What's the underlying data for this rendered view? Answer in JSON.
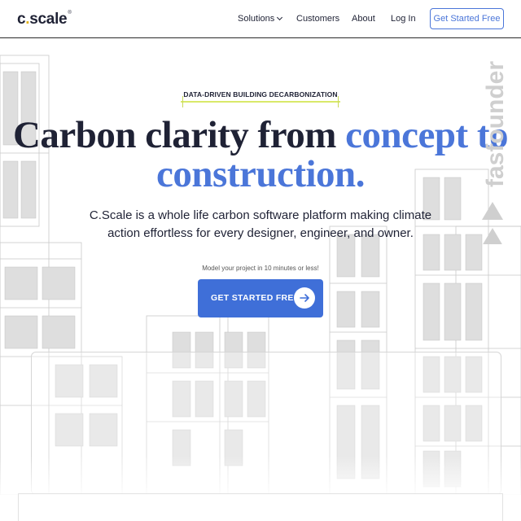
{
  "header": {
    "logo_text_1": "c",
    "logo_dot": ".",
    "logo_text_2": "scale",
    "logo_mark": "®",
    "nav": {
      "solutions": "Solutions",
      "customers": "Customers",
      "about": "About",
      "login": "Log In"
    },
    "cta_label": "Get Started Free"
  },
  "hero": {
    "eyebrow": "DATA-DRIVEN BUILDING DECARBONIZATION",
    "headline_dark": "Carbon clarity from ",
    "headline_blue_1": "concept to",
    "headline_blue_2": "construction.",
    "subtext": "C.Scale is a whole life carbon software platform making climate action effortless for every designer, engineer, and owner.",
    "note": "Model your project in 10 minutes or less!",
    "cta_label": "GET STARTED FREE"
  },
  "watermark": {
    "text": "fasfounder"
  },
  "colors": {
    "brand_blue": "#4b76d9",
    "cta_blue": "#3f6fd8",
    "logo_dot": "#e3b419",
    "text_dark": "#1f2235",
    "eyebrow_accent": "#d9e96a"
  },
  "icons": [
    "chevron-down-icon",
    "arrow-right-icon",
    "triangle-icon"
  ]
}
